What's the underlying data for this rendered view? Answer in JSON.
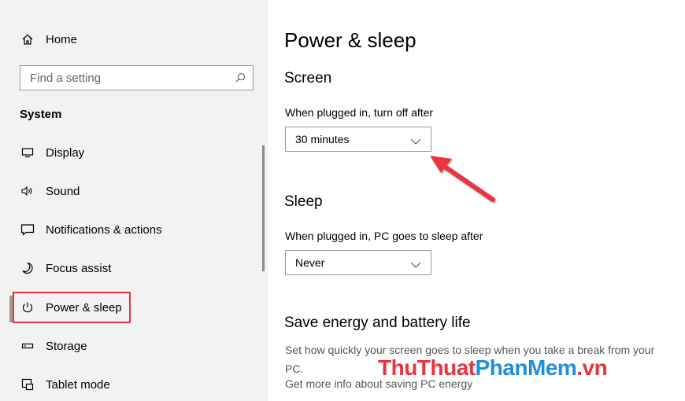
{
  "sidebar": {
    "home_label": "Home",
    "search_placeholder": "Find a setting",
    "section_title": "System",
    "items": [
      {
        "label": "Display",
        "icon": "display-icon"
      },
      {
        "label": "Sound",
        "icon": "sound-icon"
      },
      {
        "label": "Notifications & actions",
        "icon": "notifications-icon"
      },
      {
        "label": "Focus assist",
        "icon": "moon-icon"
      },
      {
        "label": "Power & sleep",
        "icon": "power-icon",
        "selected": true
      },
      {
        "label": "Storage",
        "icon": "storage-icon"
      },
      {
        "label": "Tablet mode",
        "icon": "tablet-icon"
      }
    ]
  },
  "main": {
    "title": "Power & sleep",
    "screen": {
      "heading": "Screen",
      "label": "When plugged in, turn off after",
      "value": "30 minutes"
    },
    "sleep": {
      "heading": "Sleep",
      "label": "When plugged in, PC goes to sleep after",
      "value": "Never"
    },
    "save_energy": {
      "heading": "Save energy and battery life",
      "description": "Set how quickly your screen goes to sleep when you take a break from your PC.",
      "link": "Get more info about saving PC energy"
    }
  },
  "watermark": {
    "part1": "ThuThuat",
    "part2": "PhanMem",
    "part3": ".vn"
  },
  "colors": {
    "highlight": "#e8343f",
    "watermark_blue": "#1f8fd8",
    "sidebar_bg": "#f2f2f2"
  }
}
